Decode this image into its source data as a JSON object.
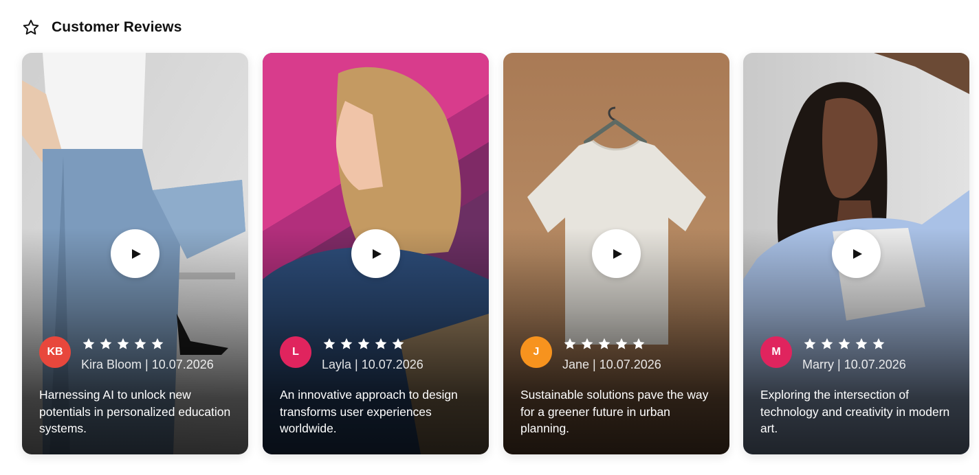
{
  "section": {
    "title": "Customer Reviews",
    "icon": "star-outline-icon"
  },
  "play_icon": "play-icon",
  "rating_icon": "star-icon",
  "reviews": [
    {
      "initials": "KB",
      "avatar_color": "#E8473C",
      "name": "Kira Bloom",
      "separator": "|",
      "date": "10.07.2026",
      "rating": 5,
      "text": "Harnessing AI to unlock new potentials in personalized education systems."
    },
    {
      "initials": "L",
      "avatar_color": "#E0245E",
      "name": "Layla",
      "separator": "|",
      "date": "10.07.2026",
      "rating": 5,
      "text": "An innovative approach to design transforms user experiences worldwide."
    },
    {
      "initials": "J",
      "avatar_color": "#F7931E",
      "name": "Jane",
      "separator": "|",
      "date": "10.07.2026",
      "rating": 5,
      "text": "Sustainable solutions pave the way for a greener future in urban planning."
    },
    {
      "initials": "M",
      "avatar_color": "#E0245E",
      "name": "Marry",
      "separator": "|",
      "date": "10.07.2026",
      "rating": 5,
      "text": "Exploring the intersection of technology and creativity in modern art."
    }
  ]
}
